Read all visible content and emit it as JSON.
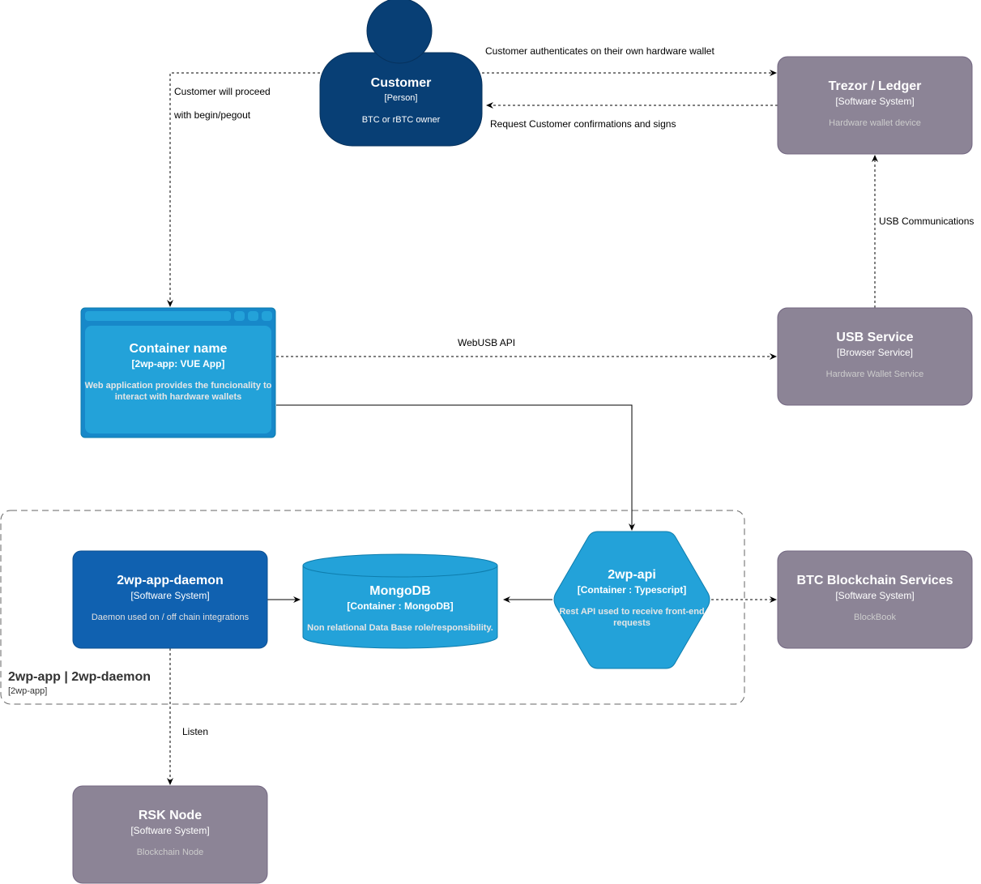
{
  "colors": {
    "person": "#083f75",
    "person_stroke": "#06315c",
    "container": "#23a2d9",
    "container_stroke": "#0e7dad",
    "system_internal": "#1061b0",
    "external": "#8c8496",
    "external_stroke": "#736782",
    "edge": "#000000",
    "boundary": "#666666"
  },
  "nodes": {
    "customer": {
      "title": "Customer",
      "type": "[Person]",
      "description": "BTC or rBTC owner"
    },
    "trezor": {
      "title": "Trezor / Ledger",
      "type": "[Software System]",
      "description": "Hardware wallet device"
    },
    "webapp": {
      "title": "Container name",
      "type": "[2wp-app: VUE App]",
      "description": "Web application provides the funcionality to interact with hardware wallets"
    },
    "usb_service": {
      "title": "USB Service",
      "type": "[Browser Service]",
      "description": "Hardware Wallet Service"
    },
    "daemon": {
      "title": "2wp-app-daemon",
      "type": "[Software System]",
      "description": "Daemon used on / off chain integrations"
    },
    "mongodb": {
      "title": "MongoDB",
      "type": "[Container : MongoDB]",
      "description": "Non relational Data Base role/responsibility."
    },
    "api": {
      "title": "2wp-api",
      "type": "[Container : Typescript]",
      "description": "Rest API used to receive front-end requests"
    },
    "btc_services": {
      "title": "BTC Blockchain Services",
      "type": "[Software System]",
      "description": "BlockBook"
    },
    "rsk_node": {
      "title": "RSK Node",
      "type": "[Software System]",
      "description": "Blockchain Node"
    }
  },
  "boundary": {
    "title": "2wp-app | 2wp-daemon",
    "subtitle": "[2wp-app]"
  },
  "edges": {
    "customer_to_webapp": {
      "line1": "Customer will proceed",
      "line2": "with begin/pegout"
    },
    "customer_to_trezor": "Customer authenticates on their own hardware wallet",
    "trezor_to_customer": "Request Customer confirmations and signs",
    "usb_to_trezor": "USB Communications",
    "webapp_to_usb": "WebUSB API",
    "daemon_to_rsk": "Listen"
  }
}
